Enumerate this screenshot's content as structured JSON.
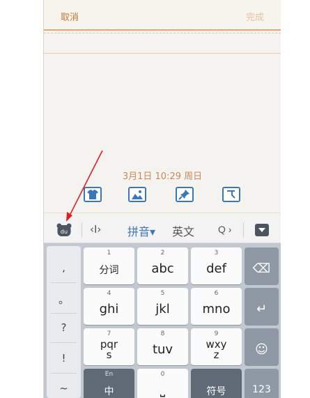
{
  "note": {
    "cancel_label": "取消",
    "done_label": "完成",
    "date": "3月1日 10:29 周日"
  },
  "toolbar": {
    "icons": [
      "shirt-icon",
      "image-icon",
      "pin-icon",
      "clock-icon"
    ]
  },
  "keyboard_bar": {
    "cursor_label": "‹I›",
    "pinyin_label": "拼音▾",
    "english_label": "英文",
    "search_label": "Q ›"
  },
  "punctuation": [
    ",",
    "。",
    "?",
    "!",
    "~"
  ],
  "keys": {
    "k1": {
      "num": "1",
      "label": "分词"
    },
    "k2": {
      "num": "2",
      "label": "abc"
    },
    "k3": {
      "num": "3",
      "label": "def"
    },
    "k4": {
      "num": "4",
      "label": "ghi"
    },
    "k5": {
      "num": "5",
      "label": "jkl"
    },
    "k6": {
      "num": "6",
      "label": "mno"
    },
    "k7": {
      "num": "7",
      "label": "pqrs"
    },
    "k8": {
      "num": "8",
      "label": "tuv"
    },
    "k9": {
      "num": "9",
      "label": "wxyz"
    },
    "en": {
      "num": "En",
      "label": "中"
    },
    "k0": {
      "num": "0",
      "label": "⎵"
    },
    "symbol": {
      "label": "符号"
    },
    "num_mode": {
      "label": "123"
    },
    "backspace": {
      "label": "⌫"
    },
    "enter": {
      "label": "↵"
    },
    "emoji": {
      "label": "☺"
    }
  },
  "colors": {
    "accent": "#c1773a",
    "keyboard_bg": "#c2c8cf",
    "annotation_arrow": "#e02020"
  }
}
